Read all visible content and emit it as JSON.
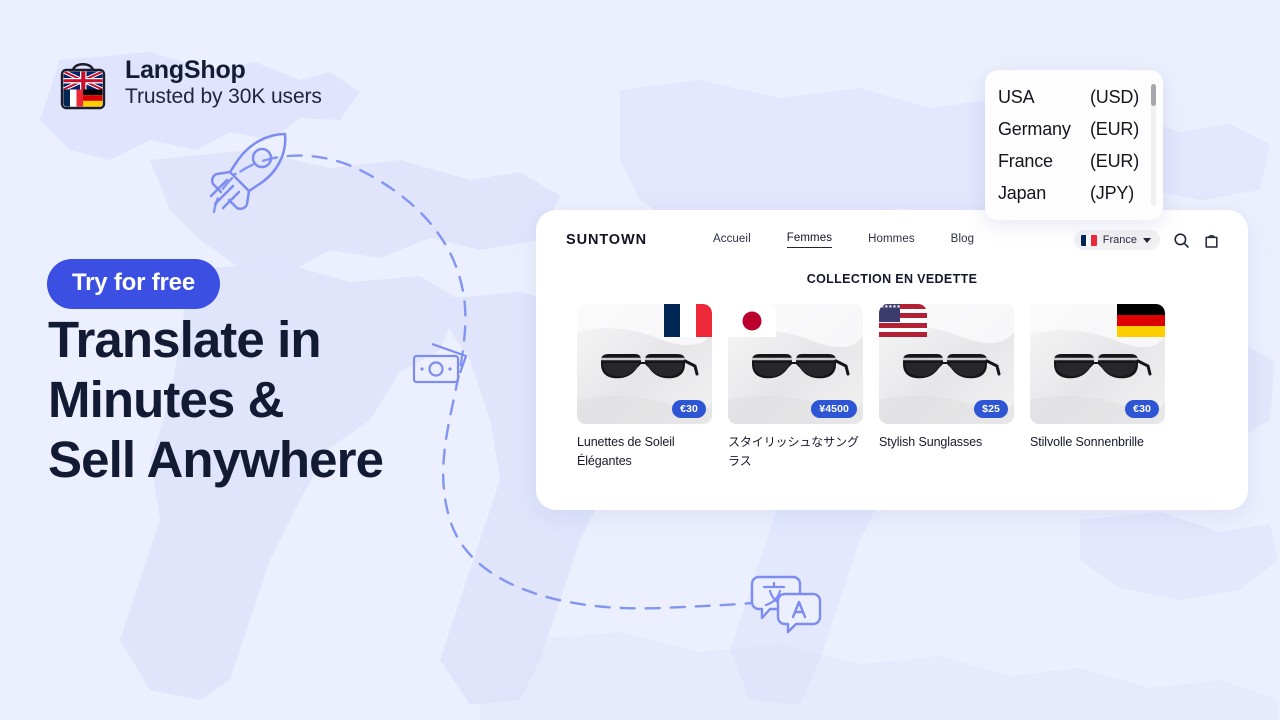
{
  "colors": {
    "background": "#ECF0FE",
    "map_land": "#DEE2FB",
    "accent_blue": "#3B4FE2",
    "price_badge": "#2E56D4",
    "deco_stroke": "#7C8CF0",
    "headline_text": "#131A33"
  },
  "brand": {
    "logo_icon": "shopping-bag-flags-icon",
    "name": "LangShop",
    "tagline": "Trusted by 30K users"
  },
  "hero": {
    "badge_label": "Try for free",
    "headline_lines": [
      "Translate in",
      "Minutes &",
      "Sell Anywhere"
    ]
  },
  "decorations": [
    {
      "icon": "rocket-icon"
    },
    {
      "icon": "money-banknotes-icon"
    },
    {
      "icon": "translate-speech-bubbles-icon"
    }
  ],
  "country_dropdown": {
    "scrollbar": "vertical-scrollbar",
    "rows": [
      {
        "country": "USA",
        "currency": "(USD)"
      },
      {
        "country": "Germany",
        "currency": "(EUR)"
      },
      {
        "country": "France",
        "currency": "(EUR)"
      },
      {
        "country": "Japan",
        "currency": "(JPY)"
      }
    ]
  },
  "store": {
    "brand": "SUNTOWN",
    "nav": [
      {
        "label": "Accueil",
        "active": false
      },
      {
        "label": "Femmes",
        "active": true
      },
      {
        "label": "Hommes",
        "active": false
      },
      {
        "label": "Blog",
        "active": false
      }
    ],
    "country_selector": {
      "flag": "fr-flag-icon",
      "label": "France",
      "caret": "chevron-down-icon"
    },
    "icons": [
      "search-icon",
      "shopping-bag-icon"
    ],
    "collection_title": "COLLECTION EN VEDETTE",
    "products": [
      {
        "flag": "fr-flag-icon",
        "price": "€30",
        "name": "Lunettes de Soleil Élégantes"
      },
      {
        "flag": "jp-flag-icon",
        "price": "¥4500",
        "name": "スタイリッシュなサングラス"
      },
      {
        "flag": "us-flag-icon",
        "price": "$25",
        "name": "Stylish Sunglasses"
      },
      {
        "flag": "de-flag-icon",
        "price": "€30",
        "name": "Stilvolle Sonnenbrille"
      }
    ]
  }
}
